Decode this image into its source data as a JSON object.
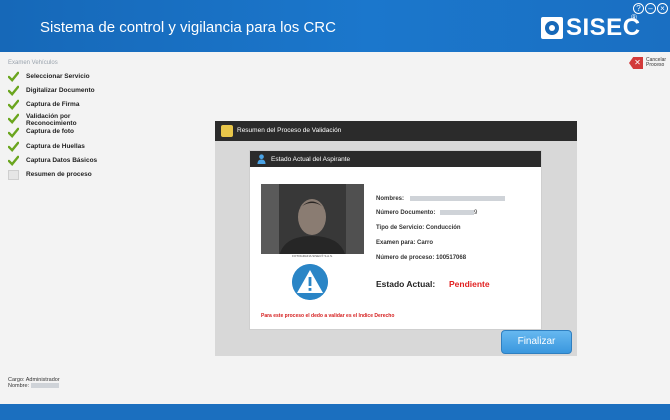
{
  "header": {
    "title": "Sistema de control y vigilancia para los CRC",
    "logo_text": "SISEC",
    "logo_reg": "®",
    "win_help": "?",
    "win_min": "–",
    "win_close": "×"
  },
  "sidebar": {
    "section_label": "Examen Vehículos",
    "steps": [
      {
        "label": "Seleccionar Servicio",
        "status": "done"
      },
      {
        "label": "Digitalizar Documento",
        "status": "done"
      },
      {
        "label": "Captura de Firma",
        "status": "done"
      },
      {
        "label": "Validación por Reconocimiento",
        "status": "done"
      },
      {
        "label": "Captura de foto",
        "status": "done"
      },
      {
        "label": "Captura de Huellas",
        "status": "done"
      },
      {
        "label": "Captura Datos Básicos",
        "status": "done"
      },
      {
        "label": "Resumen de proceso",
        "status": "current"
      }
    ],
    "cargo": "Cargo: Administrador",
    "nombre": "Nombre:"
  },
  "cancel": {
    "label_1": "Cancelar",
    "label_2": "Proceso"
  },
  "panel": {
    "title": "Resumen del Proceso de Validación"
  },
  "card": {
    "title": "Estado Actual del Aspirante",
    "photo_caption": "FOTOGRAFIA SISEC® S.A.S.",
    "fields": {
      "nombres_label": "Nombres:",
      "documento_label": "Número Documento:",
      "documento_suffix": "9",
      "tipo_label": "Tipo de Servicio:",
      "tipo_value": "Conducción",
      "examen_label": "Examen para:",
      "examen_value": "Carro",
      "proceso_label": "Número de proceso:",
      "proceso_value": "100517068"
    },
    "estado_label": "Estado Actual:",
    "estado_value": "Pendiente",
    "note": "Para este proceso el dedo a validar es el Indice Derecho"
  },
  "actions": {
    "finalizar": "Finalizar"
  },
  "colors": {
    "accent_blue": "#1b6fbf",
    "status_red": "#e12020",
    "check_green": "#6aa51e"
  }
}
